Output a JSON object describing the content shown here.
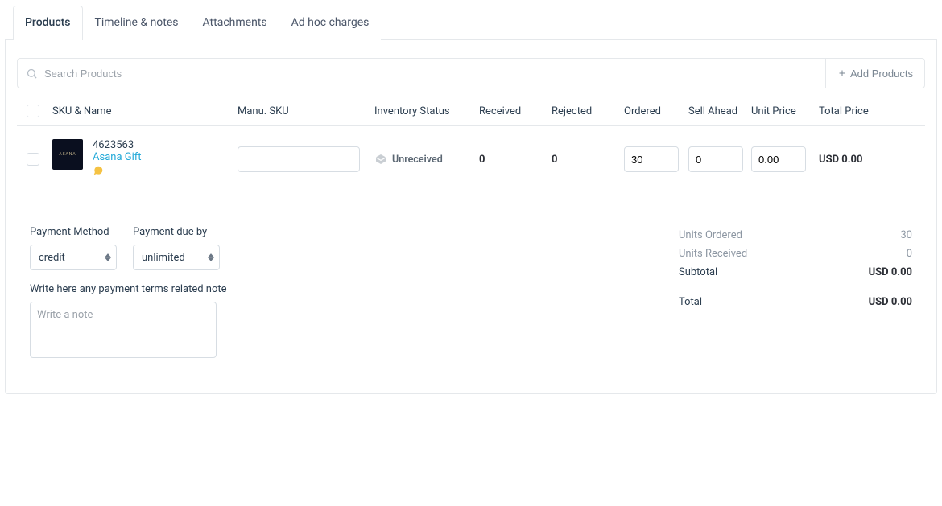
{
  "tabs": [
    "Products",
    "Timeline & notes",
    "Attachments",
    "Ad hoc charges"
  ],
  "active_tab": 0,
  "search": {
    "placeholder": "Search Products"
  },
  "add_products": "Add Products",
  "columns": {
    "sku_name": "SKU & Name",
    "manu_sku": "Manu. SKU",
    "inventory": "Inventory Status",
    "received": "Received",
    "rejected": "Rejected",
    "ordered": "Ordered",
    "sell_ahead": "Sell Ahead",
    "unit_price": "Unit Price",
    "total_price": "Total Price"
  },
  "rows": [
    {
      "sku": "4623563",
      "name": "Asana Gift",
      "manu_sku": "",
      "inventory_status": "Unreceived",
      "received": "0",
      "rejected": "0",
      "ordered": "30",
      "sell_ahead": "0",
      "unit_price": "0.00",
      "total_price": "USD 0.00"
    }
  ],
  "payment": {
    "method_label": "Payment Method",
    "method_value": "credit",
    "due_label": "Payment due by",
    "due_value": "unlimited",
    "note_label": "Write here any payment terms related note",
    "note_placeholder": "Write a note"
  },
  "totals": {
    "units_ordered_label": "Units Ordered",
    "units_ordered_value": "30",
    "units_received_label": "Units Received",
    "units_received_value": "0",
    "subtotal_label": "Subtotal",
    "subtotal_value": "USD 0.00",
    "total_label": "Total",
    "total_value": "USD 0.00"
  }
}
